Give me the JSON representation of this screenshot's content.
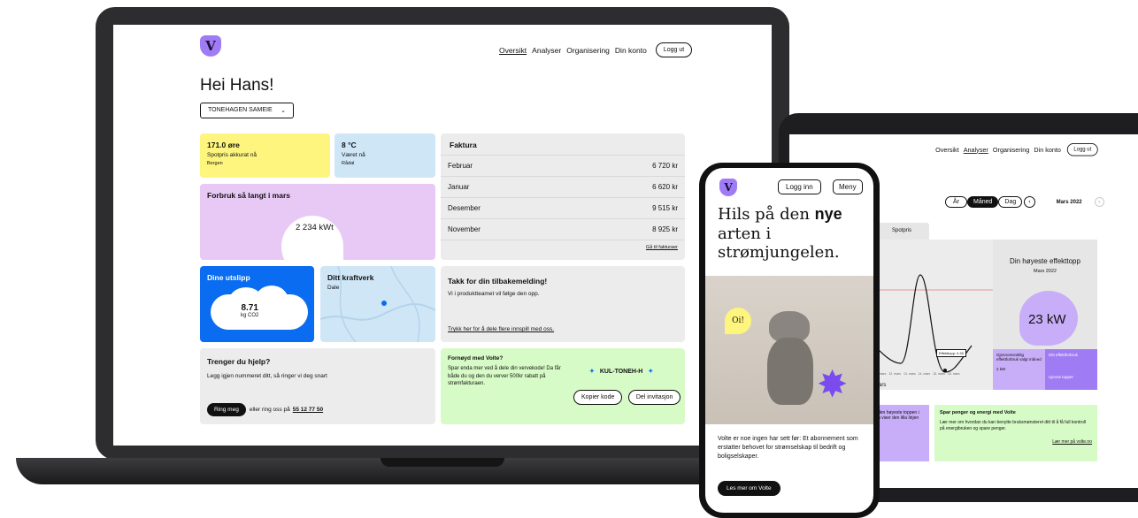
{
  "laptop": {
    "nav": {
      "items": [
        "Oversikt",
        "Analyser",
        "Organisering",
        "Din konto"
      ],
      "logout": "Logg ut"
    },
    "greeting": "Hei Hans!",
    "org_select": "TONEHAGEN SAMEIE",
    "spot": {
      "value": "171.0 øre",
      "label": "Spotpris akkurat nå",
      "place": "Bergen"
    },
    "weather": {
      "value": "8 °C",
      "label": "Været nå",
      "place": "Rådal"
    },
    "usage": {
      "title": "Forbruk så langt i mars",
      "value": "2 234 kWt"
    },
    "invoice": {
      "title": "Faktura",
      "rows": [
        {
          "month": "Februar",
          "amount": "6 720 kr"
        },
        {
          "month": "Januar",
          "amount": "6 620 kr"
        },
        {
          "month": "Desember",
          "amount": "9 515 kr"
        },
        {
          "month": "November",
          "amount": "8 925 kr"
        }
      ],
      "link": "Gå til fakturaer"
    },
    "emissions": {
      "title": "Dine utslipp",
      "value": "8.71",
      "unit": "kg CO2"
    },
    "plant": {
      "title": "Ditt kraftverk",
      "place": "Dale"
    },
    "feedback": {
      "title": "Takk for din tilbakemelding!",
      "text": "Vi i produktteamet vil følge den opp.",
      "link": "Trykk her for å dele flere innspill med oss."
    },
    "help": {
      "title": "Trenger du hjelp?",
      "text": "Legg igjen nummeret ditt, så ringer vi deg snart",
      "button": "Ring meg",
      "or_text": "eller ring oss på",
      "phone": "55 12 77 50"
    },
    "referral": {
      "title": "Fornøyd med Volte?",
      "text": "Spar enda mer ved å dele din vervekode! Da får både du og den du verver 500kr rabatt på strømfakturaen.",
      "code": "KUL-TONEH-H",
      "copy": "Kopier kode",
      "share": "Del invitasjon"
    }
  },
  "tablet": {
    "nav": {
      "items": [
        "Oversikt",
        "Analyser",
        "Organisering",
        "Din konto"
      ],
      "logout": "Logg ut"
    },
    "periods": [
      "År",
      "Måned",
      "Dag"
    ],
    "month": "Mars 2022",
    "tab": "Spotpris",
    "peak": {
      "title": "Din høyeste effekttopp",
      "sub": "Mars 2022",
      "value": "23 kW"
    },
    "avg": {
      "label": "Gjennomsnittlig effektforbruk valgt måned",
      "value": "2 kW"
    },
    "own": {
      "label": "Ditt effektforbruk",
      "link": "Ujevne topper"
    },
    "chart_label": "mars",
    "tooltip": "Effekttopp: 0.40",
    "xticks": [
      "11. mars",
      "12. mars",
      "13. mars",
      "14. mars",
      "15. mars",
      "16. mars"
    ],
    "tip_card": {
      "line1": "den høyeste toppen i",
      "line2": "n viser den lilla linjen"
    },
    "save": {
      "title": "Spar penger og energi med Volte",
      "text": "Lær mer om hvordan du kan benytte bruksmønsteret ditt til å få full kontroll på energibruken og spare penger.",
      "link": "Lær mer på volte.no"
    }
  },
  "phone": {
    "login": "Logg inn",
    "menu": "Meny",
    "headline_pre": "Hils på den ",
    "headline_bold": "nye",
    "headline_post": " arten i strømjungelen.",
    "bubble": "Oi!",
    "body": "Volte er noe ingen har sett før: Et abonnement som erstatter behovet for strømselskap til bedrift og boligselskaper.",
    "cta": "Les mer om Volte"
  },
  "colors": {
    "purple": "#a07cf4",
    "yellow": "#fdf57d",
    "green": "#d7fbc6",
    "blue": "#0a6cf0",
    "pink": "#e8c9f5",
    "lightblue": "#cfe6f7"
  }
}
